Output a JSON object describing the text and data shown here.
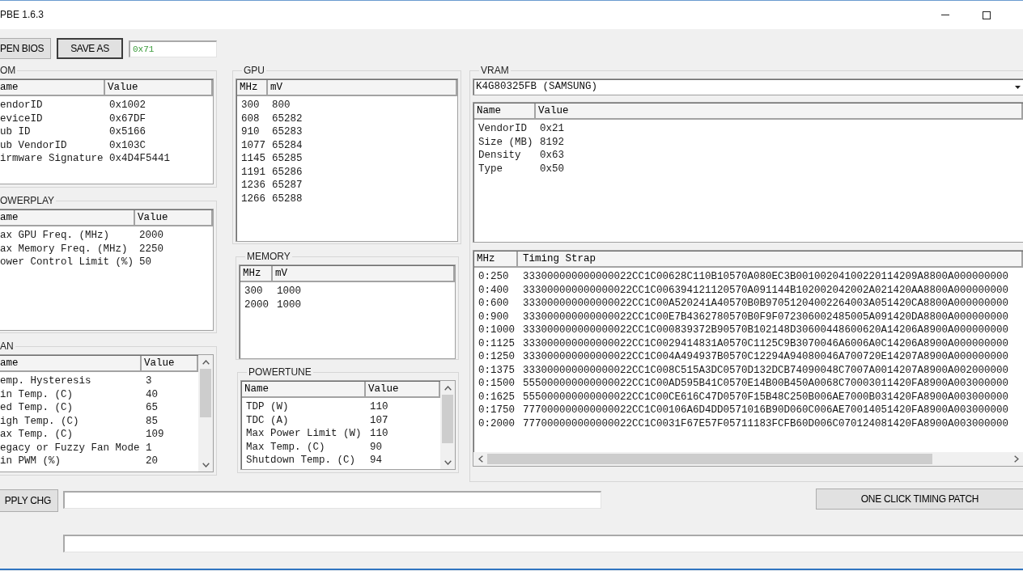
{
  "window": {
    "title": "PBE 1.6.3"
  },
  "toolbar": {
    "buttons": [
      {
        "label": "PEN BIOS",
        "focused": false
      },
      {
        "label": "SAVE AS",
        "focused": true
      }
    ],
    "hex_field": {
      "value": "0x71"
    }
  },
  "rom": {
    "title": "OM",
    "columns": [
      "ame",
      "Value"
    ],
    "rows": [
      [
        "endorID",
        "0x1002"
      ],
      [
        "eviceID",
        "0x67DF"
      ],
      [
        "ub ID",
        "0x5166"
      ],
      [
        "ub VendorID",
        "0x103C"
      ],
      [
        "irmware Signature",
        "0x4D4F5441"
      ]
    ]
  },
  "powerplay": {
    "title": "OWERPLAY",
    "columns": [
      "ame",
      "Value"
    ],
    "rows": [
      [
        "ax GPU Freq. (MHz)",
        "2000"
      ],
      [
        "ax Memory Freq. (MHz)",
        "2250"
      ],
      [
        "ower Control Limit (%)",
        "50"
      ]
    ]
  },
  "fan": {
    "title": "AN",
    "columns": [
      "ame",
      "Value"
    ],
    "rows": [
      [
        "emp. Hysteresis",
        "3"
      ],
      [
        "in Temp. (C)",
        "40"
      ],
      [
        "ed Temp. (C)",
        "65"
      ],
      [
        "igh Temp. (C)",
        "85"
      ],
      [
        "ax Temp. (C)",
        "109"
      ],
      [
        "egacy or Fuzzy Fan Mode",
        "1"
      ],
      [
        "in PWM (%)",
        "20"
      ]
    ]
  },
  "gpu": {
    "title": "GPU",
    "columns": [
      "MHz",
      "mV"
    ],
    "rows": [
      [
        "300",
        "800"
      ],
      [
        "608",
        "65282"
      ],
      [
        "910",
        "65283"
      ],
      [
        "1077",
        "65284"
      ],
      [
        "1145",
        "65285"
      ],
      [
        "1191",
        "65286"
      ],
      [
        "1236",
        "65287"
      ],
      [
        "1266",
        "65288"
      ]
    ]
  },
  "memory": {
    "title": "MEMORY",
    "columns": [
      "MHz",
      "mV"
    ],
    "rows": [
      [
        "300",
        "1000"
      ],
      [
        "2000",
        "1000"
      ]
    ]
  },
  "powertune": {
    "title": "POWERTUNE",
    "columns": [
      "Name",
      "Value"
    ],
    "rows": [
      [
        "TDP (W)",
        "110"
      ],
      [
        "TDC (A)",
        "107"
      ],
      [
        "Max Power Limit (W)",
        "110"
      ],
      [
        "Max Temp. (C)",
        "90"
      ],
      [
        "Shutdown Temp. (C)",
        "94"
      ]
    ]
  },
  "vram": {
    "title": "VRAM",
    "chip": "K4G80325FB (SAMSUNG)",
    "info": {
      "columns": [
        "Name",
        "Value"
      ],
      "rows": [
        [
          "VendorID",
          "0x21"
        ],
        [
          "Size (MB)",
          "8192"
        ],
        [
          "Density",
          "0x63"
        ],
        [
          "Type",
          "0x50"
        ]
      ]
    },
    "timings": {
      "columns": [
        "MHz",
        "Timing Strap"
      ],
      "rows": [
        [
          "0:250",
          "333000000000000022CC1C00628C110B10570A080EC3B00100204100220114209A8800A000000000"
        ],
        [
          "0:400",
          "333000000000000022CC1C006394121120570A091144B102002042002A021420AA8800A000000000"
        ],
        [
          "0:600",
          "333000000000000022CC1C00A520241A40570B0B97051204002264003A051420CA8800A000000000"
        ],
        [
          "0:900",
          "333000000000000022CC1C00E7B4362780570B0F9F072306002485005A091420DA8800A000000000"
        ],
        [
          "0:1000",
          "333000000000000022CC1C000839372B90570B102148D30600448600620A14206A8900A000000000"
        ],
        [
          "0:1125",
          "333000000000000022CC1C0029414831A0570C1125C9B3070046A6006A0C14206A8900A000000000"
        ],
        [
          "0:1250",
          "333000000000000022CC1C004A494937B0570C12294A94080046A700720E14207A8900A000000000"
        ],
        [
          "0:1375",
          "333000000000000022CC1C008C515A3DC0570D132DCB74090048C7007A0014207A8900A002000000"
        ],
        [
          "0:1500",
          "555000000000000022CC1C00AD595B41C0570E14B00B450A0068C70003011420FA8900A003000000"
        ],
        [
          "0:1625",
          "555000000000000022CC1C00CE616C47D0570F15B48C250B006AE7000B031420FA8900A003000000"
        ],
        [
          "0:1750",
          "777000000000000022CC1C00106A6D4DD0571016B90D060C006AE70014051420FA8900A003000000"
        ],
        [
          "0:2000",
          "777000000000000022CC1C0031F67E57F05711183FCFB60D006C070124081420FA8900A003000000"
        ]
      ]
    }
  },
  "actions": {
    "apply_button": "PPLY CHG",
    "timing_patch_button": "ONE CLICK TIMING PATCH"
  }
}
